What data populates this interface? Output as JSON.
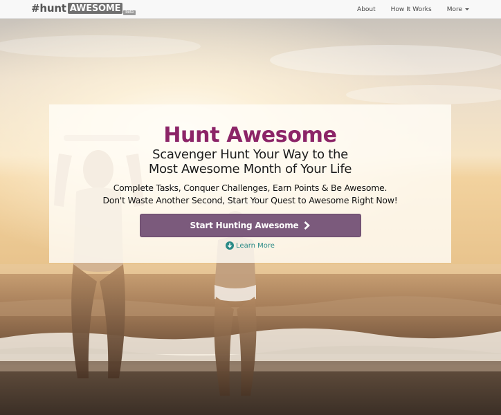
{
  "brand": {
    "hash_text": "#hunt",
    "box_text": "AWESOME",
    "badge_text": "beta"
  },
  "nav": {
    "items": [
      {
        "label": "About"
      },
      {
        "label": "How It Works"
      },
      {
        "label": "More"
      }
    ]
  },
  "hero": {
    "title": "Hunt Awesome",
    "subtitle_line1": "Scavenger Hunt Your Way to the",
    "subtitle_line2": "Most Awesome Month of Your Life",
    "body_line1": "Complete Tasks, Conquer Challenges, Earn Points & Be Awesome.",
    "body_line2": "Don't Waste Another Second, Start Your Quest to Awesome Right Now!",
    "cta_label": "Start Hunting Awesome",
    "learn_more_label": "Learn More"
  },
  "colors": {
    "title": "#8c2467",
    "cta_bg": "#7b5a7c",
    "learn_more": "#2a8a86",
    "navbar_bg": "#f8f8f8"
  },
  "icons": {
    "cta": "chevron-right-icon",
    "learn_more": "arrow-down-circle-icon",
    "more": "caret-down-icon"
  }
}
